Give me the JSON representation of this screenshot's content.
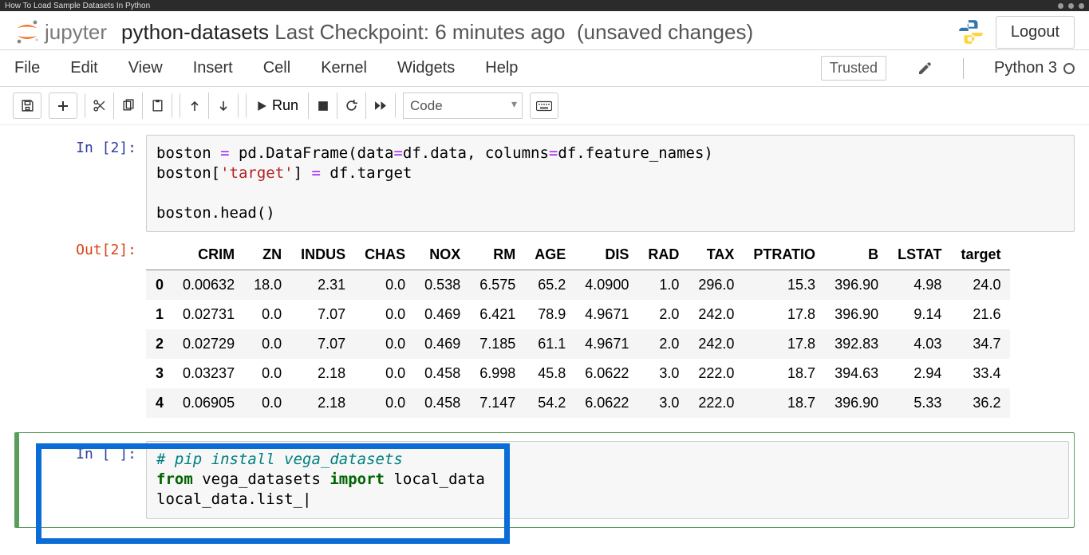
{
  "browser": {
    "tab_title": "How To Load Sample Datasets In Python"
  },
  "header": {
    "logo_text": "jupyter",
    "notebook_name": "python-datasets",
    "checkpoint": "Last Checkpoint: 6 minutes ago",
    "unsaved": "(unsaved changes)",
    "logout": "Logout"
  },
  "menubar": {
    "items": [
      "File",
      "Edit",
      "View",
      "Insert",
      "Cell",
      "Kernel",
      "Widgets",
      "Help"
    ],
    "trusted": "Trusted",
    "kernel": "Python 3"
  },
  "toolbar": {
    "run_label": "Run",
    "celltype": "Code"
  },
  "cells": {
    "in2_prompt": "In [2]:",
    "out2_prompt": "Out[2]:",
    "in_blank_prompt": "In [ ]:",
    "code2": {
      "l1a": "boston ",
      "l1b": "=",
      "l1c": " pd.DataFrame(data",
      "l1d": "=",
      "l1e": "df.data, columns",
      "l1f": "=",
      "l1g": "df.feature_names)",
      "l2a": "boston[",
      "l2b": "'target'",
      "l2c": "] ",
      "l2d": "=",
      "l2e": " df.target",
      "l3": "",
      "l4": "boston.head()"
    },
    "code3": {
      "l1": "# pip install vega_datasets",
      "l2a": "from",
      "l2b": " vega_datasets ",
      "l2c": "import",
      "l2d": " local_data",
      "l3": "local_data.list_|"
    }
  },
  "chart_data": {
    "type": "table",
    "columns": [
      "",
      "CRIM",
      "ZN",
      "INDUS",
      "CHAS",
      "NOX",
      "RM",
      "AGE",
      "DIS",
      "RAD",
      "TAX",
      "PTRATIO",
      "B",
      "LSTAT",
      "target"
    ],
    "rows": [
      [
        "0",
        "0.00632",
        "18.0",
        "2.31",
        "0.0",
        "0.538",
        "6.575",
        "65.2",
        "4.0900",
        "1.0",
        "296.0",
        "15.3",
        "396.90",
        "4.98",
        "24.0"
      ],
      [
        "1",
        "0.02731",
        "0.0",
        "7.07",
        "0.0",
        "0.469",
        "6.421",
        "78.9",
        "4.9671",
        "2.0",
        "242.0",
        "17.8",
        "396.90",
        "9.14",
        "21.6"
      ],
      [
        "2",
        "0.02729",
        "0.0",
        "7.07",
        "0.0",
        "0.469",
        "7.185",
        "61.1",
        "4.9671",
        "2.0",
        "242.0",
        "17.8",
        "392.83",
        "4.03",
        "34.7"
      ],
      [
        "3",
        "0.03237",
        "0.0",
        "2.18",
        "0.0",
        "0.458",
        "6.998",
        "45.8",
        "6.0622",
        "3.0",
        "222.0",
        "18.7",
        "394.63",
        "2.94",
        "33.4"
      ],
      [
        "4",
        "0.06905",
        "0.0",
        "2.18",
        "0.0",
        "0.458",
        "7.147",
        "54.2",
        "6.0622",
        "3.0",
        "222.0",
        "18.7",
        "396.90",
        "5.33",
        "36.2"
      ]
    ]
  }
}
